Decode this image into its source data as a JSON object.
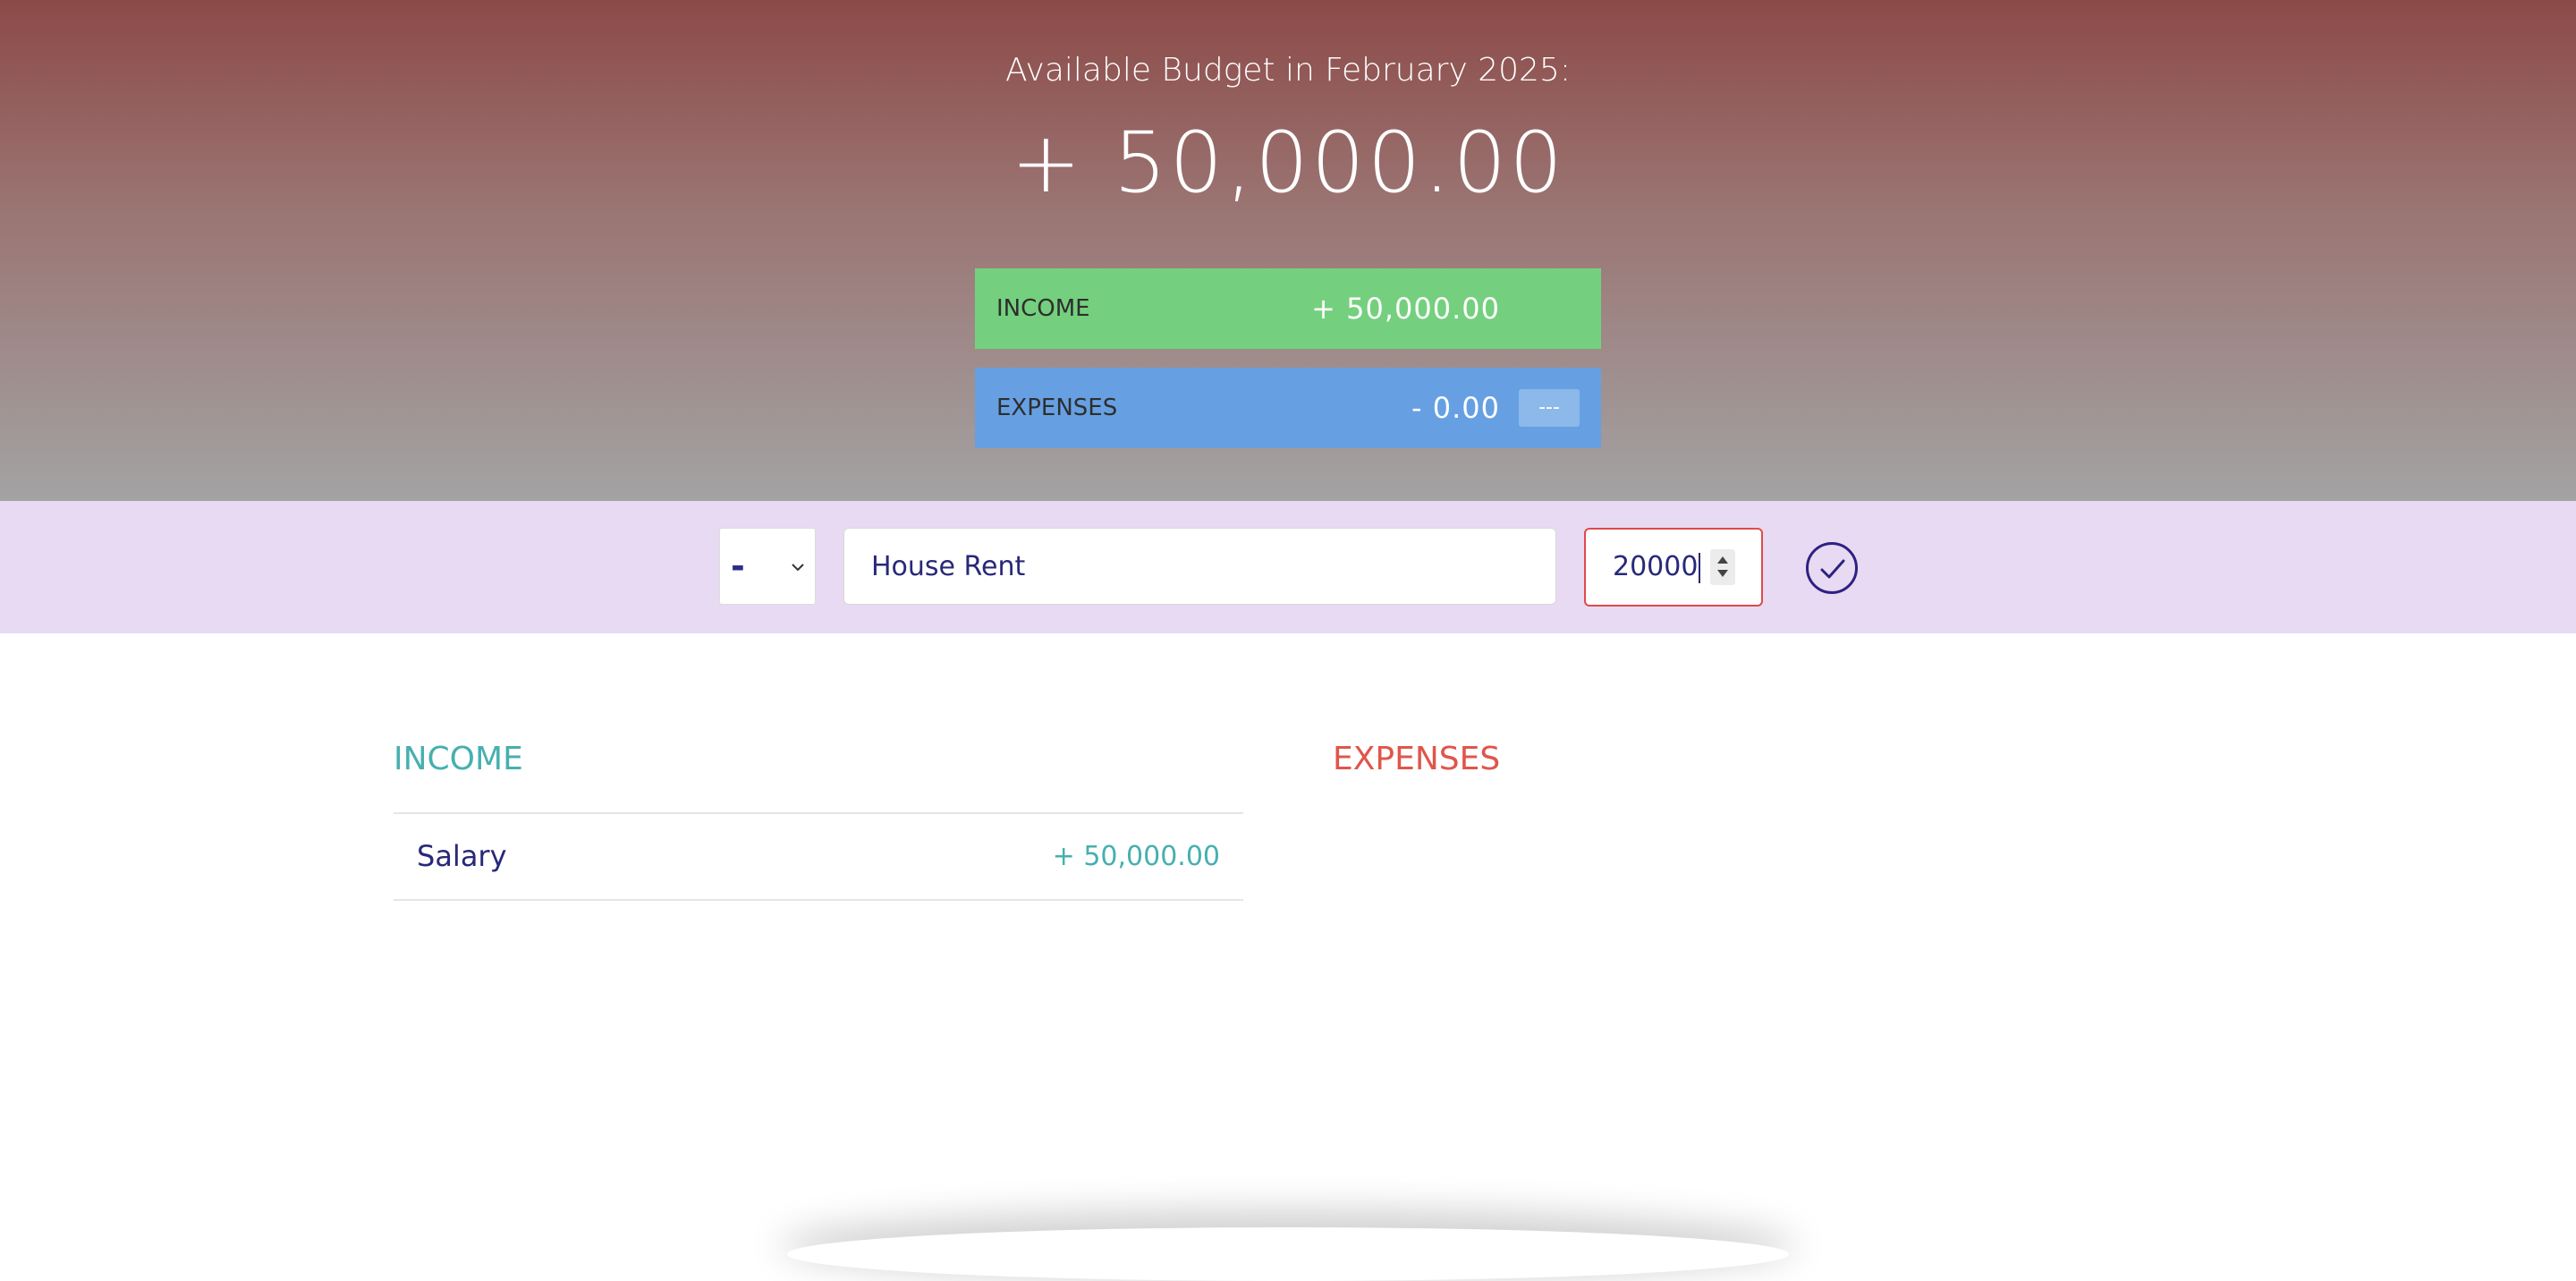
{
  "header": {
    "title": "Available Budget in February 2025:",
    "budget": "+ 50,000.00"
  },
  "summary": {
    "income_label": "INCOME",
    "income_value": "+ 50,000.00",
    "expenses_label": "EXPENSES",
    "expenses_value": "- 0.00",
    "expenses_percentage": "---"
  },
  "add_form": {
    "type_value": "-",
    "description_value": "House Rent",
    "amount_value": "20000",
    "icons": [
      "chevron-down-icon",
      "checkmark-icon"
    ]
  },
  "income_list": {
    "title": "INCOME",
    "items": [
      {
        "description": "Salary",
        "value": "+ 50,000.00"
      }
    ]
  },
  "expenses_list": {
    "title": "EXPENSES",
    "items": []
  },
  "colors": {
    "income": "#74d07e",
    "expenses": "#66a0e3",
    "income_text": "#46b0ae",
    "expenses_text": "#e0564a",
    "add_bar": "#e7daf2",
    "accent": "#2d2280"
  }
}
